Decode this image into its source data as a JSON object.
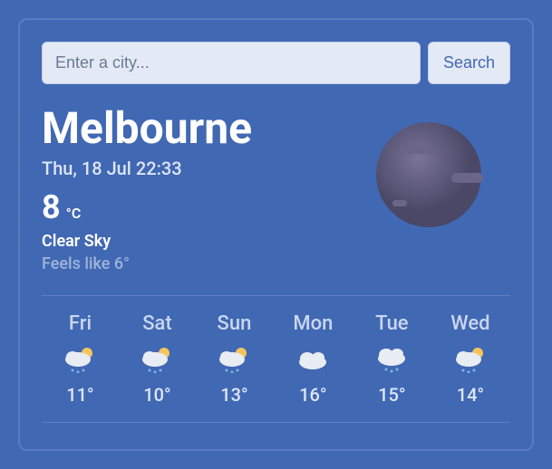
{
  "search": {
    "placeholder": "Enter a city...",
    "button": "Search"
  },
  "current": {
    "city": "Melbourne",
    "date": "Thu, 18 Jul 22:33",
    "temp": "8",
    "unit": "°C",
    "condition": "Clear Sky",
    "feels": "Feels like 6°"
  },
  "forecast": [
    {
      "day": "Fri",
      "temp": "11°",
      "icon": "rain-sun"
    },
    {
      "day": "Sat",
      "temp": "10°",
      "icon": "rain-sun"
    },
    {
      "day": "Sun",
      "temp": "13°",
      "icon": "rain-sun"
    },
    {
      "day": "Mon",
      "temp": "16°",
      "icon": "cloud"
    },
    {
      "day": "Tue",
      "temp": "15°",
      "icon": "cloud-rain"
    },
    {
      "day": "Wed",
      "temp": "14°",
      "icon": "rain-sun"
    }
  ]
}
